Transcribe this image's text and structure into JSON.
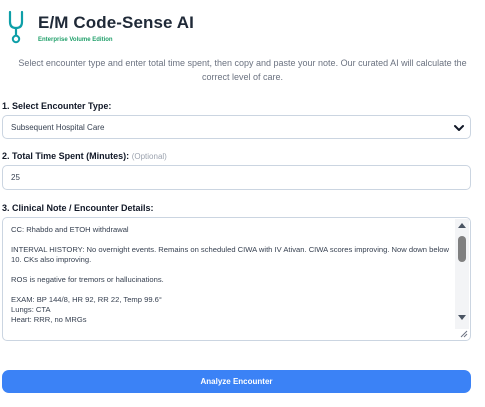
{
  "app": {
    "title": "E/M Code-Sense AI",
    "subtitle": "Enterprise Volume Edition",
    "logo_icon": "stethoscope-icon"
  },
  "intro": "Select encounter type and enter total time spent, then copy and paste your note. Our curated AI will calculate the correct level of care.",
  "encounter": {
    "label": "1. Select Encounter Type:",
    "value": "Subsequent Hospital Care",
    "icon": "chevron-down-icon"
  },
  "time": {
    "label": "2. Total Time Spent (Minutes):",
    "optional": "(Optional)",
    "value": "25"
  },
  "note": {
    "label": "3. Clinical Note / Encounter Details:",
    "text": "CC: Rhabdo and ETOH withdrawal\n\nINTERVAL HISTORY: No overnight events. Remains on scheduled CIWA with IV Ativan. CIWA scores improving. Now down below 10. CKs also improving.\n\nROS is negative for tremors or hallucinations.\n\nEXAM: BP 144/8, HR 92, RR 22, Temp 99.6°\nLungs: CTA\nHeart: RRR, no MRGs"
  },
  "analyze_button": {
    "label": "Analyze Encounter"
  },
  "colors": {
    "accent": "#3b82f6",
    "brand_green": "#22a06b",
    "logo_teal": "#0e9fa8"
  }
}
